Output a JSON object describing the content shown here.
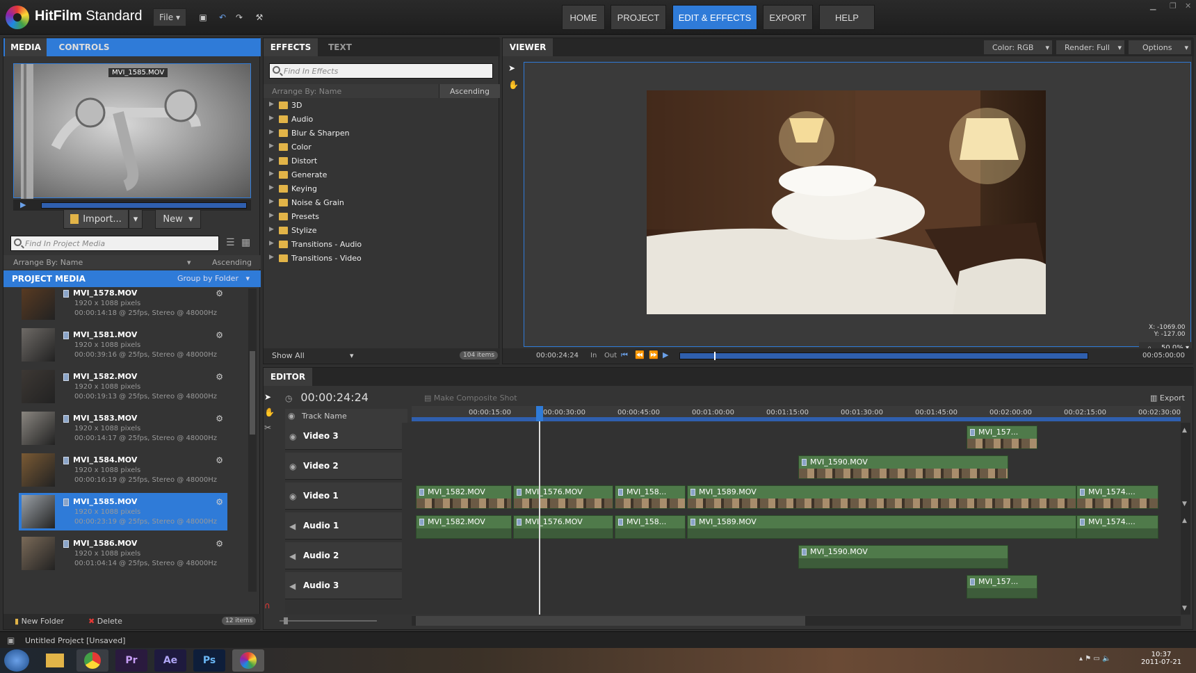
{
  "app": {
    "name_bold": "HitFilm",
    "name_rest": " Standard",
    "file_menu": "File"
  },
  "nav": {
    "home": "HOME",
    "project": "PROJECT",
    "edit": "EDIT & EFFECTS",
    "export": "EXPORT",
    "help": "HELP"
  },
  "media_panel": {
    "tabs": [
      "MEDIA",
      "CONTROLS"
    ],
    "preview_label": "MVI_1585.MOV",
    "import_label": "Import...",
    "new_label": "New",
    "search_placeholder": "Find In Project Media",
    "arrange_label": "Arrange By: Name",
    "sort_label": "Ascending",
    "section_title": "PROJECT MEDIA",
    "group_label": "Group by Folder",
    "items": [
      {
        "name": "MVI_1578.MOV",
        "res": "1920 x 1088 pixels",
        "info": "00:00:14:18 @ 25fps, Stereo @ 48000Hz",
        "color": "#5a3b22"
      },
      {
        "name": "MVI_1581.MOV",
        "res": "1920 x 1088 pixels",
        "info": "00:00:39:16 @ 25fps, Stereo @ 48000Hz",
        "color": "#6e6a66"
      },
      {
        "name": "MVI_1582.MOV",
        "res": "1920 x 1088 pixels",
        "info": "00:00:19:13 @ 25fps, Stereo @ 48000Hz",
        "color": "#3d3834"
      },
      {
        "name": "MVI_1583.MOV",
        "res": "1920 x 1088 pixels",
        "info": "00:00:14:17 @ 25fps, Stereo @ 48000Hz",
        "color": "#8a8680"
      },
      {
        "name": "MVI_1584.MOV",
        "res": "1920 x 1088 pixels",
        "info": "00:00:16:19 @ 25fps, Stereo @ 48000Hz",
        "color": "#7a5a34"
      },
      {
        "name": "MVI_1585.MOV",
        "res": "1920 x 1088 pixels",
        "info": "00:00:23:19 @ 25fps, Stereo @ 48000Hz",
        "color": "#9aa0a6"
      },
      {
        "name": "MVI_1586.MOV",
        "res": "1920 x 1088 pixels",
        "info": "00:01:04:14 @ 25fps, Stereo @ 48000Hz",
        "color": "#7a6a58"
      }
    ],
    "selected_index": 5,
    "new_folder_label": "New Folder",
    "delete_label": "Delete",
    "count_label": "12 items"
  },
  "effects_panel": {
    "tabs": [
      "EFFECTS",
      "TEXT"
    ],
    "search_placeholder": "Find In Effects",
    "arrange_label": "Arrange By: Name",
    "sort_label": "Ascending",
    "folders": [
      "3D",
      "Audio",
      "Blur & Sharpen",
      "Color",
      "Distort",
      "Generate",
      "Keying",
      "Noise & Grain",
      "Presets",
      "Stylize",
      "Transitions - Audio",
      "Transitions - Video"
    ],
    "show_all_label": "Show All",
    "count_label": "104 items"
  },
  "viewer": {
    "tab": "VIEWER",
    "color_label": "Color: RGB",
    "render_label": "Render: Full",
    "options_label": "Options",
    "coord_x": "X: -1069.00",
    "coord_y": "Y: -127.00",
    "zoom": "50.0%",
    "current_time": "00:00:24:24",
    "in_label": "In",
    "out_label": "Out",
    "duration": "00:05:00:00",
    "playhead_fraction": 0.083
  },
  "editor": {
    "tab": "EDITOR",
    "timecode": "00:00:24:24",
    "composite_label": "Make Composite Shot",
    "export_label": "Export",
    "track_name_header": "Track Name",
    "ruler": [
      "00:00:15:00",
      "00:00:30:00",
      "00:00:45:00",
      "00:01:00:00",
      "00:01:15:00",
      "00:01:30:00",
      "00:01:45:00",
      "00:02:00:00",
      "00:02:15:00",
      "00:02:30:00"
    ],
    "tracks": [
      "Video 3",
      "Video 2",
      "Video 1",
      "Audio 1",
      "Audio 2",
      "Audio 3"
    ],
    "clips": {
      "v3": [
        "MVI_157..."
      ],
      "v2": [
        "MVI_1590.MOV"
      ],
      "v1": [
        "MVI_1582.MOV",
        "MVI_1576.MOV",
        "MVI_158...",
        "MVI_1589.MOV",
        "MVI_1574...."
      ],
      "a1": [
        "MVI_1582.MOV",
        "MVI_1576.MOV",
        "MVI_158...",
        "MVI_1589.MOV",
        "MVI_1574...."
      ],
      "a2": [
        "MVI_1590.MOV"
      ],
      "a3": [
        "MVI_157..."
      ]
    }
  },
  "status": {
    "project": "Untitled Project  [Unsaved]"
  },
  "taskbar": {
    "time": "10:37",
    "date": "2011-07-21",
    "apps": [
      "Pr",
      "Ae",
      "Ps"
    ]
  },
  "colors": {
    "accent": "#2f7bd8",
    "clip": "#4f7a4a"
  }
}
